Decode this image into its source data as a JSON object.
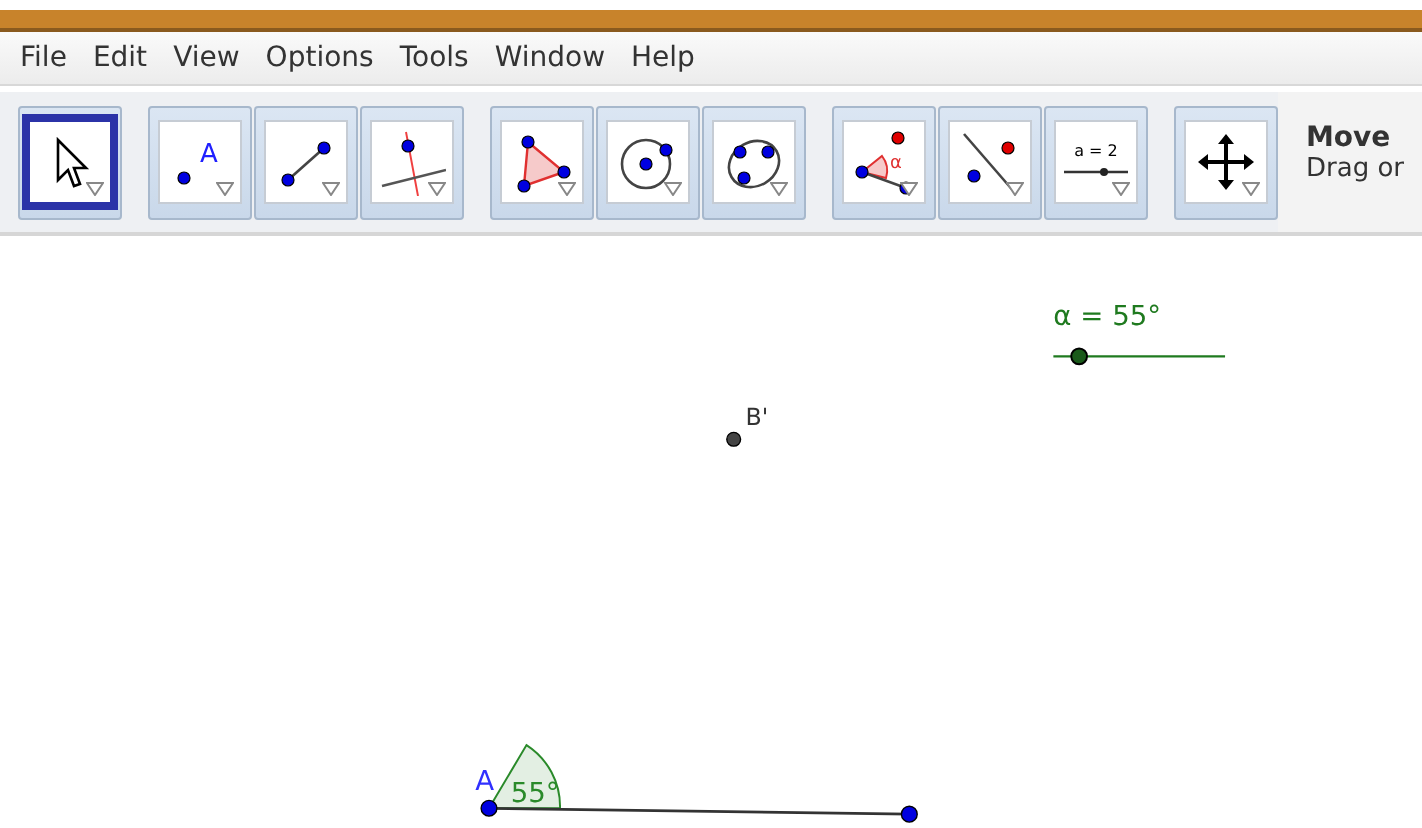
{
  "menu": [
    "File",
    "Edit",
    "View",
    "Options",
    "Tools",
    "Window",
    "Help"
  ],
  "tool_groups": [
    [
      {
        "kind": "move",
        "selected": true
      }
    ],
    [
      {
        "kind": "point",
        "label": "A",
        "selected": false
      },
      {
        "kind": "segment",
        "selected": false
      },
      {
        "kind": "perpendicular",
        "selected": false
      }
    ],
    [
      {
        "kind": "polygon",
        "selected": false
      },
      {
        "kind": "circle",
        "selected": false
      },
      {
        "kind": "conic",
        "selected": false
      }
    ],
    [
      {
        "kind": "angle",
        "label": "α",
        "selected": false
      },
      {
        "kind": "reflect",
        "selected": false
      },
      {
        "kind": "slider",
        "label": "a = 2",
        "selected": false
      }
    ],
    [
      {
        "kind": "move-view",
        "selected": false
      }
    ]
  ],
  "tool_help": {
    "title": "Move",
    "text": "Drag or"
  },
  "canvas": {
    "slider": {
      "label": "α = 55°",
      "level": 0.15
    },
    "points": [
      {
        "label": "B'",
        "kind": "free"
      },
      {
        "label": "A",
        "kind": "vertex"
      },
      {
        "kind": "end"
      }
    ],
    "angle": {
      "label": "55°"
    }
  }
}
